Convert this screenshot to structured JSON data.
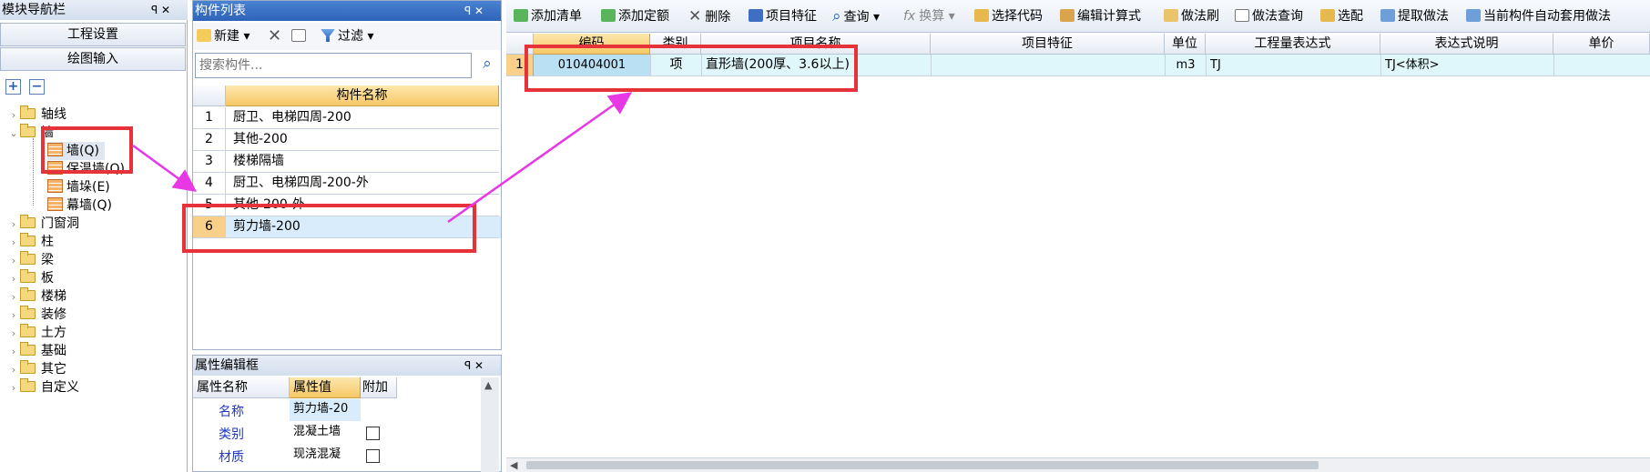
{
  "nav": {
    "title": "模块导航栏",
    "pin": "ꟼ ✕",
    "btn_settings": "工程设置",
    "btn_drawing": "绘图输入",
    "expand_icon": "+",
    "collapse_icon": "−",
    "tree": {
      "axis": "轴线",
      "wall": "墙",
      "wall_q": "墙(Q)",
      "insulation": "保温墙(Q)",
      "pier": "墙垛(E)",
      "curtain": "幕墙(Q)",
      "door": "门窗洞",
      "column": "柱",
      "beam": "梁",
      "slab": "板",
      "stair": "楼梯",
      "deco": "装修",
      "earth": "土方",
      "found": "基础",
      "other": "其它",
      "custom": "自定义"
    }
  },
  "complist": {
    "title": "构件列表",
    "pin": "ꟼ ✕",
    "new_label": "新建",
    "filter_label": "过滤",
    "search_placeholder": "搜索构件...",
    "col_name": "构件名称",
    "rows": [
      {
        "n": "1",
        "name": "厨卫、电梯四周-200"
      },
      {
        "n": "2",
        "name": "其他-200"
      },
      {
        "n": "3",
        "name": "楼梯隔墙"
      },
      {
        "n": "4",
        "name": "厨卫、电梯四周-200-外"
      },
      {
        "n": "5",
        "name": "其他-200-外"
      },
      {
        "n": "6",
        "name": "剪力墙-200"
      }
    ]
  },
  "props": {
    "title": "属性编辑框",
    "pin": "ꟼ ✕",
    "col_name": "属性名称",
    "col_value": "属性值",
    "col_extra": "附加",
    "rows": [
      {
        "name": "名称",
        "value": "剪力墙-20"
      },
      {
        "name": "类别",
        "value": "混凝土墙"
      },
      {
        "name": "材质",
        "value": "现浇混凝"
      }
    ]
  },
  "toolbar": {
    "add_list": "添加清单",
    "add_quota": "添加定额",
    "delete": "删除",
    "feature": "项目特征",
    "query": "查询",
    "convert": "换算",
    "select_code": "选择代码",
    "edit_formula": "编辑计算式",
    "method_brush": "做法刷",
    "method_query": "做法查询",
    "pick": "选配",
    "extract": "提取做法",
    "auto_apply": "当前构件自动套用做法"
  },
  "main": {
    "headers": [
      "编码",
      "类别",
      "项目名称",
      "项目特征",
      "单位",
      "工程量表达式",
      "表达式说明",
      "单价"
    ],
    "rows": [
      {
        "n": "1",
        "code": "010404001",
        "type": "项",
        "name": "直形墙(200厚、3.6以上)",
        "feature": "",
        "unit": "m3",
        "expr": "TJ",
        "desc": "TJ<体积>",
        "price": ""
      }
    ]
  },
  "colors": {
    "highlight": "#e8323a",
    "arrow": "#e838e6",
    "header_gold": "#f6c866",
    "selected_row": "#d9ecfb"
  }
}
